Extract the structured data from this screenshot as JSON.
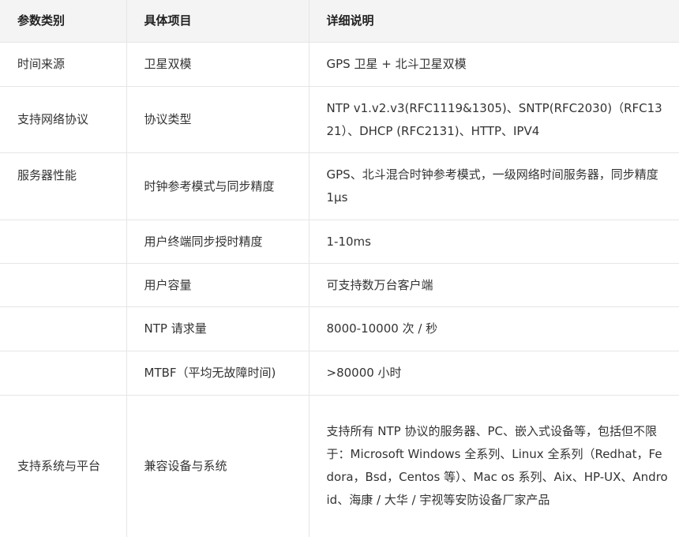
{
  "headers": [
    "参数类别",
    "具体项目",
    "详细说明"
  ],
  "rows": [
    {
      "category": "时间来源",
      "item": "卫星双模",
      "detail": "GPS 卫星 + 北斗卫星双模"
    },
    {
      "category": "支持网络协议",
      "item": "协议类型",
      "detail": "NTP v1.v2.v3(RFC1119&1305)、SNTP(RFC2030)（RFC1321）、DHCP (RFC2131)、HTTP、IPV4"
    },
    {
      "category": "服务器性能",
      "item": "时钟参考模式与同步精度",
      "detail": "GPS、北斗混合时钟参考模式，一级网络时间服务器，同步精度 1μs"
    },
    {
      "category": "",
      "item": "用户终端同步授时精度",
      "detail": "1-10ms"
    },
    {
      "category": "",
      "item": "用户容量",
      "detail": "可支持数万台客户端"
    },
    {
      "category": "",
      "item": "NTP 请求量",
      "detail": "8000-10000 次 / 秒"
    },
    {
      "category": "",
      "item": "MTBF（平均无故障时间)",
      "detail": ">80000 小时"
    },
    {
      "category": "支持系统与平台",
      "item": "兼容设备与系统",
      "detail": "支持所有 NTP 协议的服务器、PC、嵌入式设备等，包括但不限于：Microsoft Windows 全系列、Linux 全系列（Redhat，Fedora，Bsd，Centos 等）、Mac os 系列、Aix、HP-UX、Android、海康 / 大华 / 宇视等安防设备厂家产品"
    }
  ]
}
